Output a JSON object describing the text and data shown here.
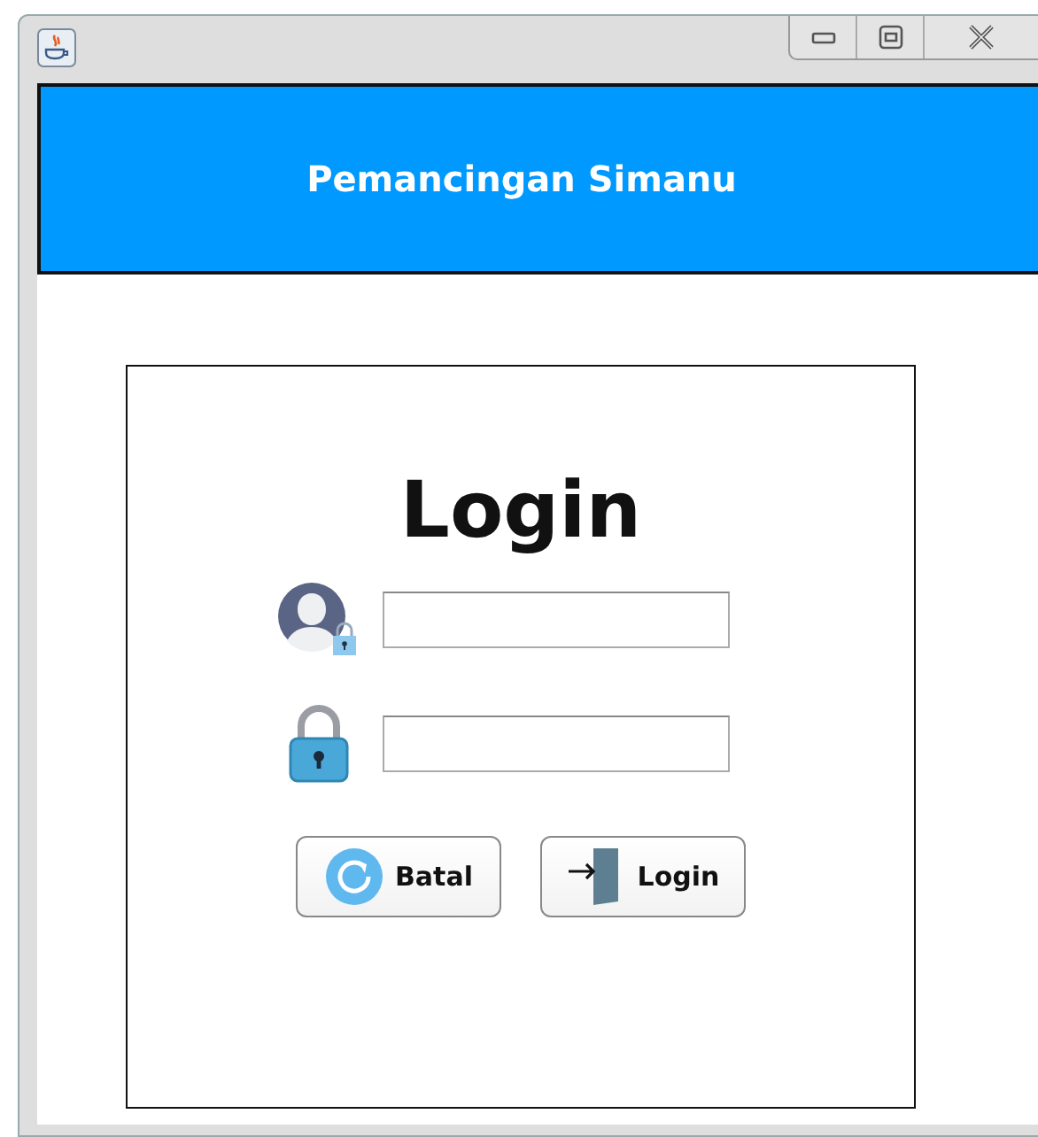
{
  "header": {
    "title": "Pemancingan Simanu"
  },
  "form": {
    "heading": "Login",
    "fields": [
      {
        "kind": "user"
      },
      {
        "kind": "password"
      }
    ],
    "buttons": [
      {
        "kind": "cancel",
        "label": "Batal"
      },
      {
        "kind": "login",
        "label": "Login"
      }
    ]
  }
}
